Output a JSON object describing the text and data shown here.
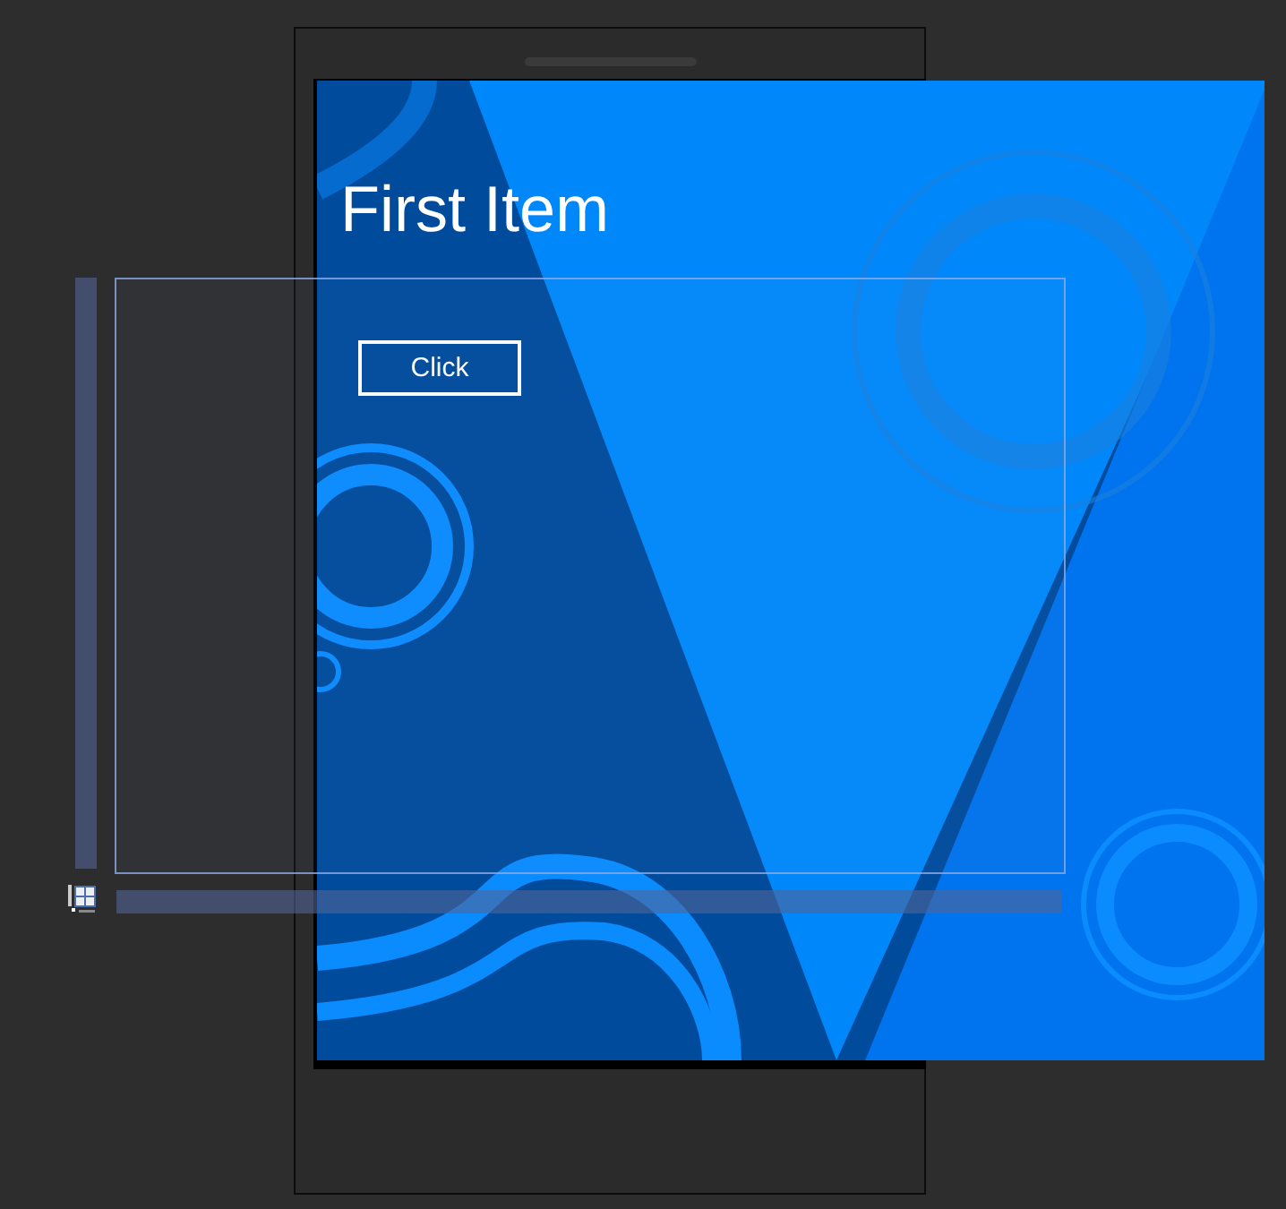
{
  "page_title": "First Item",
  "button": {
    "label": "Click"
  }
}
